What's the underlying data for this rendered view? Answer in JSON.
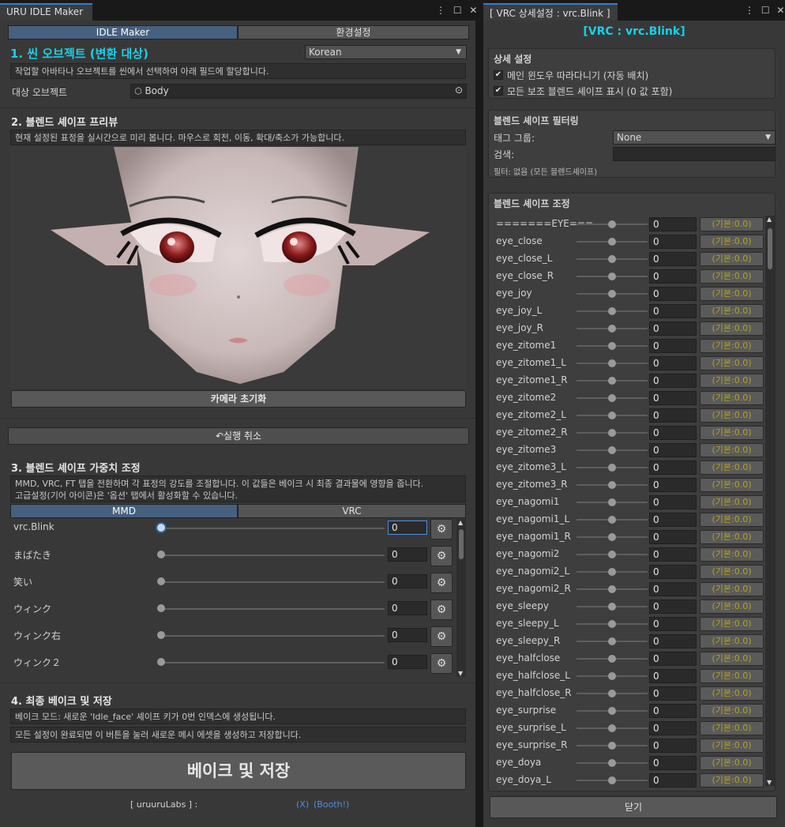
{
  "left_window": {
    "tab_title": "URU IDLE Maker",
    "menu_icon": "⋮",
    "maximize_icon": "☐",
    "close_icon": "✕",
    "tabs": [
      {
        "label": "IDLE Maker",
        "active": true
      },
      {
        "label": "환경설정",
        "active": false
      }
    ],
    "section1": {
      "title": "1. 씬 오브젝트 (변환 대상)",
      "language": "Korean",
      "help": "작업할 아바타나 오브젝트를 씬에서 선택하여 아래 필드에 할당합니다.",
      "target_label": "대상 오브젝트",
      "target_value": "Body"
    },
    "section2": {
      "title": "2. 블렌드 셰이프 프리뷰",
      "help": "현재 설정된 표정을 실시간으로 미리 봅니다. 마우스로 회전, 이동, 확대/축소가 가능합니다.",
      "reset_camera": "카메라 초기화"
    },
    "undo_label": "↶실행 취소",
    "section3": {
      "title": "3. 블렌드 셰이프 가중치 조정",
      "help_line1": "MMD, VRC, FT 탭을 전환하며 각 표정의 강도를 조절합니다. 이 값들은 베이크 시 최종 결과물에 영향을 줍니다.",
      "help_line2": "고급설정(기어 아이콘)은 '옵션' 탭에서 활성화할 수 있습니다.",
      "tabs": [
        {
          "label": "MMD",
          "active": true
        },
        {
          "label": "VRC",
          "active": false
        }
      ],
      "gear_glyph": "⚙",
      "rows": [
        {
          "label": "vrc.Blink",
          "value": "0",
          "selected": true
        },
        {
          "label": "まばたき",
          "value": "0",
          "selected": false
        },
        {
          "label": "笑い",
          "value": "0",
          "selected": false
        },
        {
          "label": "ウィンク",
          "value": "0",
          "selected": false
        },
        {
          "label": "ウィンク右",
          "value": "0",
          "selected": false
        },
        {
          "label": "ウィンク２",
          "value": "0",
          "selected": false
        }
      ]
    },
    "section4": {
      "title": "4. 최종 베이크 및 저장",
      "help1": "베이크 모드: 새로운 'Idle_face' 셰이프 키가 0번 인덱스에 생성됩니다.",
      "help2": "모든 설정이 완료되면 이 버튼을 눌러 새로운 메시 에셋을 생성하고 저장합니다.",
      "bake_button": "베이크 및 저장"
    },
    "footer": {
      "credit": "[ uruuruLabs ] :",
      "link_x": "(X)",
      "link_booth": "(Booth!)"
    }
  },
  "right_window": {
    "tab_title": "[ VRC 상세설정 : vrc.Blink ]",
    "header": "[VRC : vrc.Blink]",
    "detail": {
      "title": "상세 설정",
      "check_glyph": "✔",
      "opt1": "메인 윈도우 따라다니기 (자동 배치)",
      "opt2": "모든 보조 블렌드 셰이프 표시 (0 값 포함)"
    },
    "filter": {
      "title": "블렌드 셰이프 필터링",
      "tag_label": "태그 그룹:",
      "tag_value": "None",
      "search_label": "검색:",
      "search_value": "",
      "status": "필터: 없음 (모든 블렌드셰이프)"
    },
    "adjust": {
      "title": "블렌드 셰이프 조정",
      "rows": [
        {
          "name": "=======EYE===",
          "value": "0",
          "default": "(기본:0.0)"
        },
        {
          "name": "eye_close",
          "value": "0",
          "default": "(기본:0.0)"
        },
        {
          "name": "eye_close_L",
          "value": "0",
          "default": "(기본:0.0)"
        },
        {
          "name": "eye_close_R",
          "value": "0",
          "default": "(기본:0.0)"
        },
        {
          "name": "eye_joy",
          "value": "0",
          "default": "(기본:0.0)"
        },
        {
          "name": "eye_joy_L",
          "value": "0",
          "default": "(기본:0.0)"
        },
        {
          "name": "eye_joy_R",
          "value": "0",
          "default": "(기본:0.0)"
        },
        {
          "name": "eye_zitome1",
          "value": "0",
          "default": "(기본:0.0)"
        },
        {
          "name": "eye_zitome1_L",
          "value": "0",
          "default": "(기본:0.0)"
        },
        {
          "name": "eye_zitome1_R",
          "value": "0",
          "default": "(기본:0.0)"
        },
        {
          "name": "eye_zitome2",
          "value": "0",
          "default": "(기본:0.0)"
        },
        {
          "name": "eye_zitome2_L",
          "value": "0",
          "default": "(기본:0.0)"
        },
        {
          "name": "eye_zitome2_R",
          "value": "0",
          "default": "(기본:0.0)"
        },
        {
          "name": "eye_zitome3",
          "value": "0",
          "default": "(기본:0.0)"
        },
        {
          "name": "eye_zitome3_L",
          "value": "0",
          "default": "(기본:0.0)"
        },
        {
          "name": "eye_zitome3_R",
          "value": "0",
          "default": "(기본:0.0)"
        },
        {
          "name": "eye_nagomi1",
          "value": "0",
          "default": "(기본:0.0)"
        },
        {
          "name": "eye_nagomi1_L",
          "value": "0",
          "default": "(기본:0.0)"
        },
        {
          "name": "eye_nagomi1_R",
          "value": "0",
          "default": "(기본:0.0)"
        },
        {
          "name": "eye_nagomi2",
          "value": "0",
          "default": "(기본:0.0)"
        },
        {
          "name": "eye_nagomi2_L",
          "value": "0",
          "default": "(기본:0.0)"
        },
        {
          "name": "eye_nagomi2_R",
          "value": "0",
          "default": "(기본:0.0)"
        },
        {
          "name": "eye_sleepy",
          "value": "0",
          "default": "(기본:0.0)"
        },
        {
          "name": "eye_sleepy_L",
          "value": "0",
          "default": "(기본:0.0)"
        },
        {
          "name": "eye_sleepy_R",
          "value": "0",
          "default": "(기본:0.0)"
        },
        {
          "name": "eye_halfclose",
          "value": "0",
          "default": "(기본:0.0)"
        },
        {
          "name": "eye_halfclose_L",
          "value": "0",
          "default": "(기본:0.0)"
        },
        {
          "name": "eye_halfclose_R",
          "value": "0",
          "default": "(기본:0.0)"
        },
        {
          "name": "eye_surprise",
          "value": "0",
          "default": "(기본:0.0)"
        },
        {
          "name": "eye_surprise_L",
          "value": "0",
          "default": "(기본:0.0)"
        },
        {
          "name": "eye_surprise_R",
          "value": "0",
          "default": "(기본:0.0)"
        },
        {
          "name": "eye_doya",
          "value": "0",
          "default": "(기본:0.0)"
        },
        {
          "name": "eye_doya_L",
          "value": "0",
          "default": "(기본:0.0)"
        }
      ]
    },
    "close_button": "닫기"
  },
  "colors": {
    "accent_cyan": "#19d0e6",
    "default_label": "#b2a422",
    "active_tab": "#46607f",
    "link": "#4d8fe0"
  }
}
